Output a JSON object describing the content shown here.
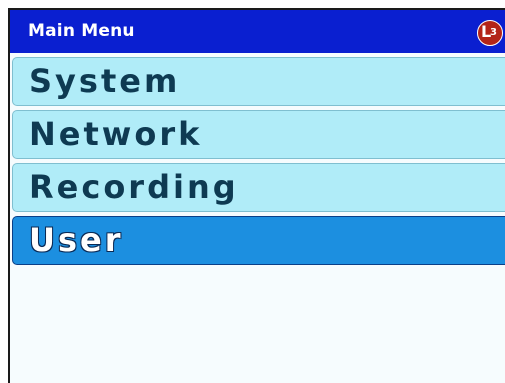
{
  "title_bar": {
    "title": "Main Menu",
    "logo": {
      "letter": "L",
      "sub": "3",
      "color": "#b32418"
    }
  },
  "colors": {
    "title_bar_bg": "#0a1fd0",
    "item_bg": "#b0ecf8",
    "item_text": "#0e3a52",
    "selected_bg": "#1c8fe0",
    "selected_text": "#ffffff"
  },
  "menu": {
    "items": [
      {
        "label": "System",
        "selected": false
      },
      {
        "label": "Network",
        "selected": false
      },
      {
        "label": "Recording",
        "selected": false
      },
      {
        "label": "User",
        "selected": true
      }
    ]
  }
}
